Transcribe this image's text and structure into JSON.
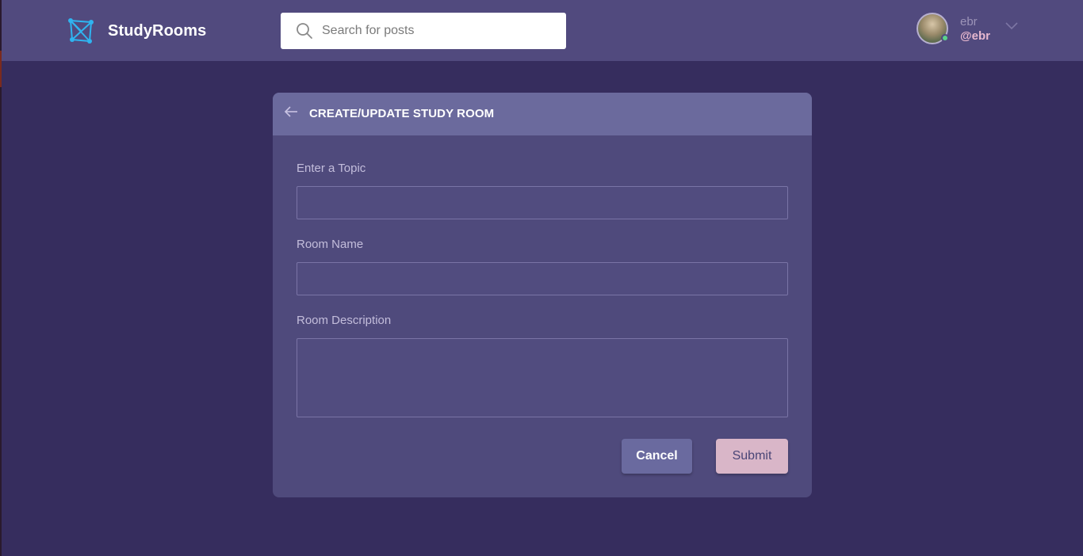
{
  "header": {
    "app_name": "StudyRooms",
    "search": {
      "placeholder": "Search for posts",
      "value": ""
    },
    "user": {
      "name": "ebr",
      "handle": "@ebr",
      "status": "online"
    }
  },
  "form": {
    "title": "CREATE/UPDATE STUDY ROOM",
    "fields": [
      {
        "label": "Enter a Topic",
        "value": ""
      },
      {
        "label": "Room Name",
        "value": ""
      },
      {
        "label": "Room Description",
        "value": ""
      }
    ],
    "cancel_label": "Cancel",
    "submit_label": "Submit"
  },
  "colors": {
    "background": "#362d5e",
    "header": "#514a7e",
    "card": "#4f4a7c",
    "card_header": "#6b6a9d",
    "logo_accent": "#2fb4f0",
    "cancel_button": "#6a6a9f",
    "submit_button": "#d9b6c8",
    "online_dot": "#59d38b"
  },
  "icons": [
    "logo-icon",
    "search-icon",
    "chevron-down-icon",
    "arrow-left-icon"
  ]
}
